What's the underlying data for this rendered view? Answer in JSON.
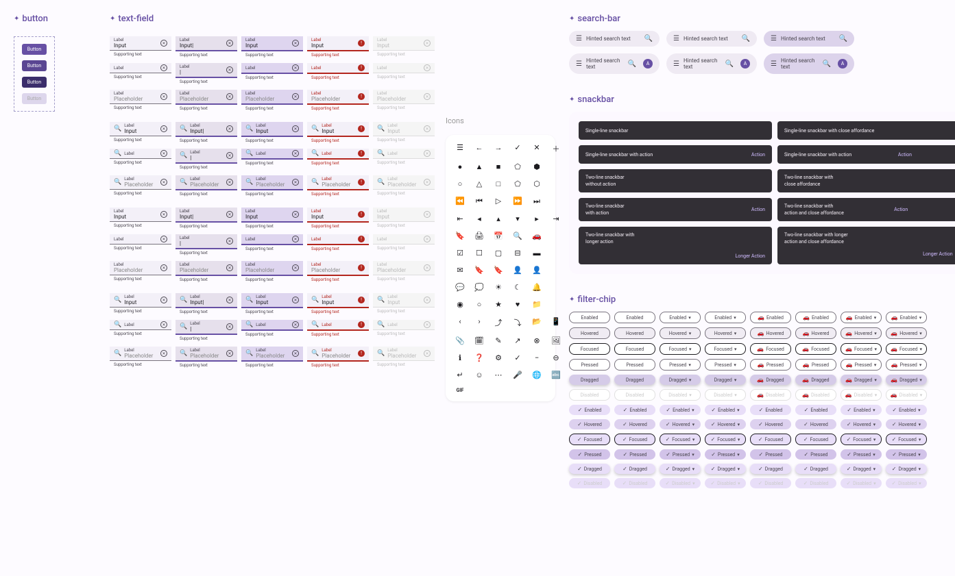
{
  "sections": {
    "button": "button",
    "textfield": "text-field",
    "icons": "Icons",
    "searchbar": "search-bar",
    "snackbar": "snackbar",
    "filterchip": "filter-chip"
  },
  "buttons": [
    "Button",
    "Button",
    "Button",
    "Button"
  ],
  "textfield": {
    "label": "Label",
    "input": "Input",
    "inputCursor": "Input|",
    "placeholder": "Placeholder",
    "supporting": "Supporting text"
  },
  "searchbar": {
    "hint": "Hinted search text",
    "avatar": "A"
  },
  "snackbars": {
    "r1c1": "Single-line snackbar",
    "r1c2": "Single-line snackbar with close affordance",
    "r2c1": "Single-line snackbar with action",
    "r2c2": "Single-line snackbar with action",
    "r3c1a": "Two-line snackbar",
    "r3c1b": "without action",
    "r3c2a": "Two-line snackbar with",
    "r3c2b": "close affordance",
    "r4c1a": "Two-line snackbar",
    "r4c1b": "with action",
    "r4c2a": "Two-line snackbar with",
    "r4c2b": "action and close affordance",
    "r5c1a": "Two-line snackbar with",
    "r5c1b": "longer action",
    "r5c2a": "Two-line snackbar with longer",
    "r5c2b": "action and close affordance",
    "action": "Action",
    "longerAction": "Longer Action"
  },
  "chipStates": [
    "Enabled",
    "Hovered",
    "Focused",
    "Pressed",
    "Dragged",
    "Disabled"
  ]
}
